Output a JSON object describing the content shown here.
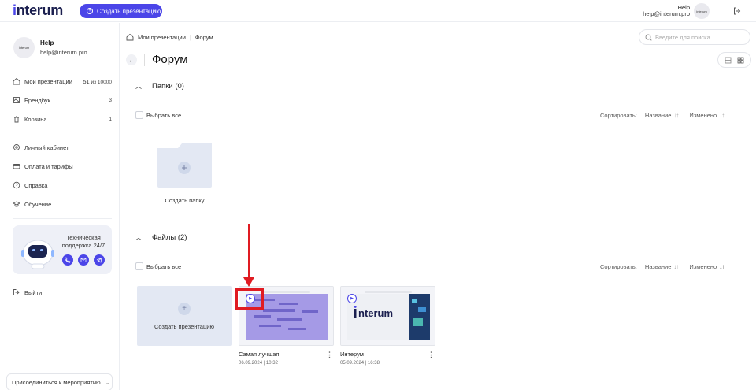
{
  "header": {
    "logo": "interum",
    "create_button": "Создать презентацию",
    "user_name": "Help",
    "user_email": "help@interum.pro",
    "avatar_text": "interum"
  },
  "sidebar": {
    "avatar_text": "interum",
    "user_name": "Help",
    "user_email": "help@interum.pro",
    "items": [
      {
        "label": "Мои презентации",
        "count": "51",
        "count_suffix": "из 10000",
        "icon": "home-icon"
      },
      {
        "label": "Брендбук",
        "count": "3",
        "icon": "brandbook-icon"
      },
      {
        "label": "Корзина",
        "count": "1",
        "icon": "trash-icon"
      },
      {
        "label": "Личный кабинет",
        "icon": "settings-icon"
      },
      {
        "label": "Оплата и тарифы",
        "icon": "card-icon"
      },
      {
        "label": "Справка",
        "icon": "help-icon"
      },
      {
        "label": "Обучение",
        "icon": "education-icon"
      }
    ],
    "support_text_1": "Техническая",
    "support_text_2": "поддержка 24/7",
    "logout": "Выйти",
    "join_event": "Присоединиться к мероприятию"
  },
  "breadcrumb": {
    "root": "Мои презентации",
    "current": "Форум"
  },
  "search": {
    "placeholder": "Введите для поиска"
  },
  "page_title": "Форум",
  "folders_section": {
    "title": "Папки (0)",
    "select_all": "Выбрать все",
    "sort_label": "Сортировать:",
    "sort_name": "Название",
    "sort_modified": "Изменено",
    "create_folder": "Создать папку"
  },
  "files_section": {
    "title": "Файлы (2)",
    "select_all": "Выбрать все",
    "sort_label": "Сортировать:",
    "sort_name": "Название",
    "sort_modified": "Изменено",
    "create_presentation": "Создать презентацию",
    "files": [
      {
        "name": "Самая лучшая",
        "date": "06.09.2024 | 10:32"
      },
      {
        "name": "Интерум",
        "date": "05.09.2024 | 16:38"
      }
    ]
  },
  "colors": {
    "accent": "#4b45e8",
    "annotation_red": "#e01b22"
  }
}
